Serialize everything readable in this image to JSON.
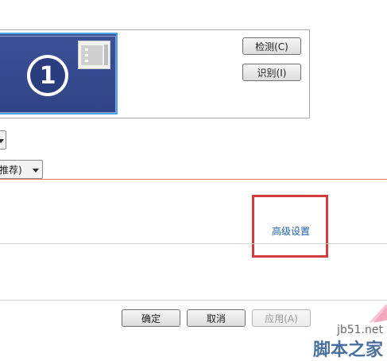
{
  "monitor_preview": {
    "display_number": "1"
  },
  "buttons": {
    "detect": "检测(C)",
    "identify": "识别(I)",
    "ok": "确定",
    "cancel": "取消",
    "apply": "应用(A)"
  },
  "resolution_dropdown": {
    "visible_text": "推荐)"
  },
  "advanced_settings_link": "高级设置",
  "watermark": {
    "line1": "jb51.net",
    "line2": "脚本之家"
  }
}
